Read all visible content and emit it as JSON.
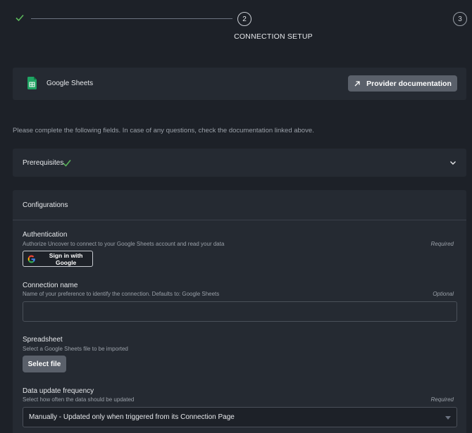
{
  "stepper": {
    "step1": {
      "state": "complete",
      "icon": "check-icon"
    },
    "step2": {
      "number": "2",
      "label": "CONNECTION SETUP"
    },
    "step3": {
      "number": "3"
    }
  },
  "provider": {
    "name": "Google Sheets",
    "icon": "google-sheets-icon",
    "doc_button": "Provider documentation",
    "doc_icon": "external-link-icon"
  },
  "instructions": "Please complete the following fields. In case of any questions, check the documentation linked above.",
  "prerequisites": {
    "title": "Prerequisites",
    "status_icon": "check-icon",
    "expand_icon": "chevron-down-icon"
  },
  "configurations": {
    "title": "Configurations",
    "authentication": {
      "label": "Authentication",
      "description": "Authorize Uncover to connect to your Google Sheets account and read your data",
      "tag": "Required",
      "button": "Sign in with Google"
    },
    "connection_name": {
      "label": "Connection name",
      "description": "Name of your preference to identify the connection. Defaults to: Google Sheets",
      "tag": "Optional",
      "value": "",
      "placeholder": ""
    },
    "spreadsheet": {
      "label": "Spreadsheet",
      "description": "Select a Google Sheets file to be imported",
      "button": "Select file"
    },
    "frequency": {
      "label": "Data update frequency",
      "description": "Select how often the data should be updated",
      "tag": "Required",
      "selected": "Manually - Updated only when triggered from its Connection Page"
    }
  },
  "colors": {
    "background": "#1d2128",
    "card": "#252a32",
    "accent_green": "#5cb85c",
    "button_gray": "#5a606a"
  }
}
